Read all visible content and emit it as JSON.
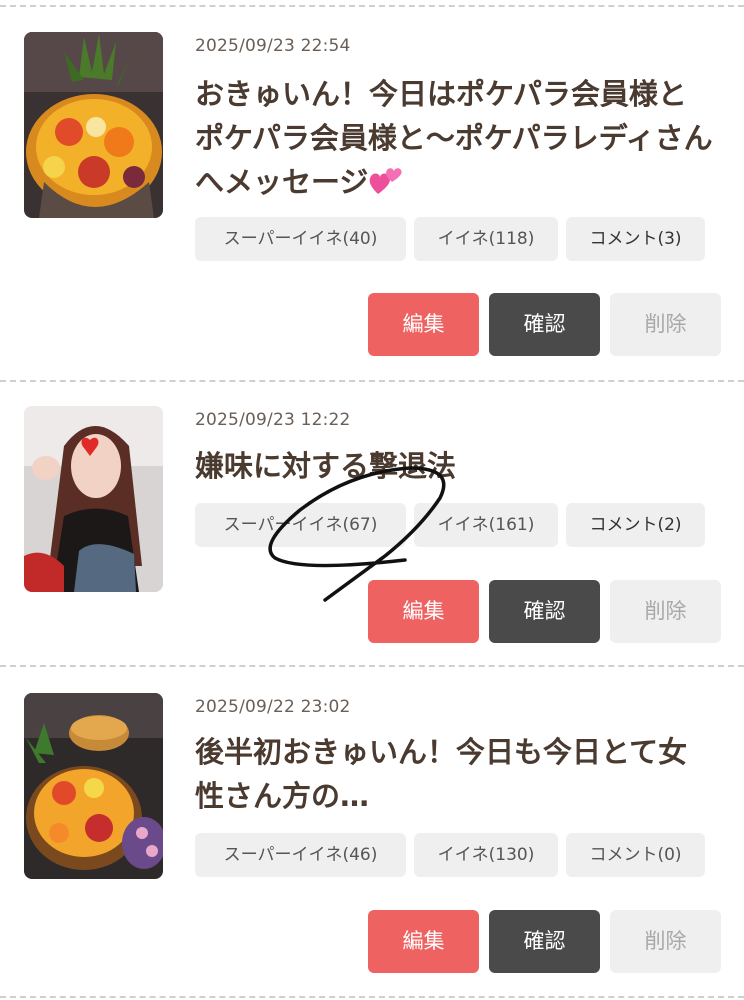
{
  "posts": [
    {
      "date": "2025/09/23 22:54",
      "title": "おきゅいん！今日はポケパラ会員様とポケパラ会員様と〜ポケパラレディさんへメッセージ",
      "title_emoji": "two-hearts-icon",
      "super_like": "スーパーイイネ(40)",
      "like": "イイネ(118)",
      "comment": "コメント(3)",
      "edit": "編集",
      "confirm": "確認",
      "delete": "削除",
      "thumbnail": "fruit-platter-image"
    },
    {
      "date": "2025/09/23 12:22",
      "title": "嫌味に対する撃退法",
      "super_like": "スーパーイイネ(67)",
      "like": "イイネ(161)",
      "comment": "コメント(2)",
      "edit": "編集",
      "confirm": "確認",
      "delete": "削除",
      "thumbnail": "woman-portrait-image"
    },
    {
      "date": "2025/09/22 23:02",
      "title": "後半初おきゅいん！今日も今日とて女性さん方の…",
      "super_like": "スーパーイイネ(46)",
      "like": "イイネ(130)",
      "comment": "コメント(0)",
      "edit": "編集",
      "confirm": "確認",
      "delete": "削除",
      "thumbnail": "fruit-cake-platter-image"
    }
  ],
  "colors": {
    "edit_button": "#ee6262",
    "confirm_button": "#4a4a4a",
    "delete_button": "#efefef",
    "title_text": "#4a3a2f"
  }
}
